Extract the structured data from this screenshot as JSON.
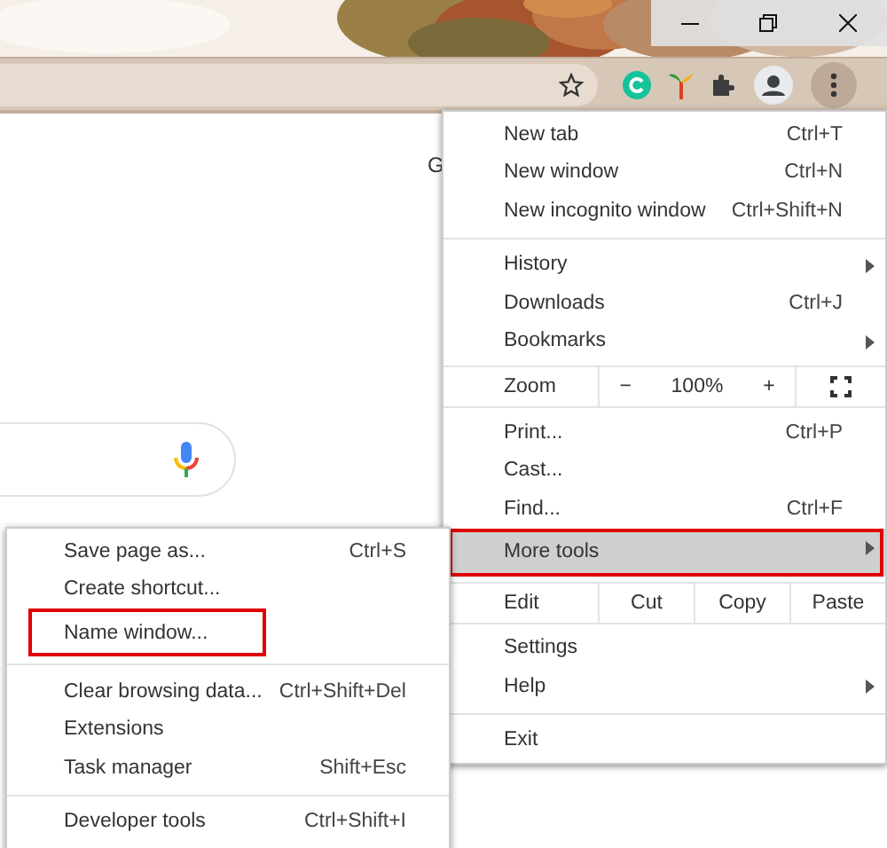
{
  "page": {
    "text_fragment": "G"
  },
  "main_menu": {
    "items": [
      {
        "kind": "item",
        "label": "New tab",
        "shortcut": "Ctrl+T",
        "submenu": false,
        "highlighted": false,
        "annotated": false
      },
      {
        "kind": "item",
        "label": "New window",
        "shortcut": "Ctrl+N",
        "submenu": false,
        "highlighted": false,
        "annotated": false
      },
      {
        "kind": "item",
        "label": "New incognito window",
        "shortcut": "Ctrl+Shift+N",
        "submenu": false,
        "highlighted": false,
        "annotated": false
      },
      {
        "kind": "separator"
      },
      {
        "kind": "item",
        "label": "History",
        "submenu": true,
        "highlighted": false,
        "annotated": false
      },
      {
        "kind": "item",
        "label": "Downloads",
        "shortcut": "Ctrl+J",
        "submenu": false,
        "highlighted": false,
        "annotated": false
      },
      {
        "kind": "item",
        "label": "Bookmarks",
        "submenu": true,
        "highlighted": false,
        "annotated": false
      },
      {
        "kind": "zoom",
        "label": "Zoom",
        "minus": "−",
        "value": "100%",
        "plus": "+"
      },
      {
        "kind": "item",
        "label": "Print...",
        "shortcut": "Ctrl+P",
        "submenu": false,
        "highlighted": false,
        "annotated": false
      },
      {
        "kind": "item",
        "label": "Cast...",
        "submenu": false,
        "highlighted": false,
        "annotated": false
      },
      {
        "kind": "item",
        "label": "Find...",
        "shortcut": "Ctrl+F",
        "submenu": false,
        "highlighted": false,
        "annotated": false
      },
      {
        "kind": "item",
        "label": "More tools",
        "submenu": true,
        "highlighted": true,
        "annotated": true
      },
      {
        "kind": "edit",
        "label": "Edit",
        "actions": [
          "Cut",
          "Copy",
          "Paste"
        ]
      },
      {
        "kind": "item",
        "label": "Settings",
        "submenu": false,
        "highlighted": false,
        "annotated": false
      },
      {
        "kind": "item",
        "label": "Help",
        "submenu": true,
        "highlighted": false,
        "annotated": false
      },
      {
        "kind": "separator"
      },
      {
        "kind": "item",
        "label": "Exit",
        "submenu": false,
        "highlighted": false,
        "annotated": false
      }
    ]
  },
  "more_tools_menu": {
    "items": [
      {
        "kind": "item",
        "label": "Save page as...",
        "shortcut": "Ctrl+S",
        "submenu": false,
        "highlighted": false,
        "annotated": false
      },
      {
        "kind": "item",
        "label": "Create shortcut...",
        "submenu": false,
        "highlighted": false,
        "annotated": false
      },
      {
        "kind": "item",
        "label": "Name window...",
        "submenu": false,
        "highlighted": false,
        "annotated": true
      },
      {
        "kind": "separator"
      },
      {
        "kind": "item",
        "label": "Clear browsing data...",
        "shortcut": "Ctrl+Shift+Del",
        "submenu": false,
        "highlighted": false,
        "annotated": false
      },
      {
        "kind": "item",
        "label": "Extensions",
        "submenu": false,
        "highlighted": false,
        "annotated": false
      },
      {
        "kind": "item",
        "label": "Task manager",
        "shortcut": "Shift+Esc",
        "submenu": false,
        "highlighted": false,
        "annotated": false
      },
      {
        "kind": "separator"
      },
      {
        "kind": "item",
        "label": "Developer tools",
        "shortcut": "Ctrl+Shift+I",
        "submenu": false,
        "highlighted": false,
        "annotated": false
      }
    ]
  }
}
